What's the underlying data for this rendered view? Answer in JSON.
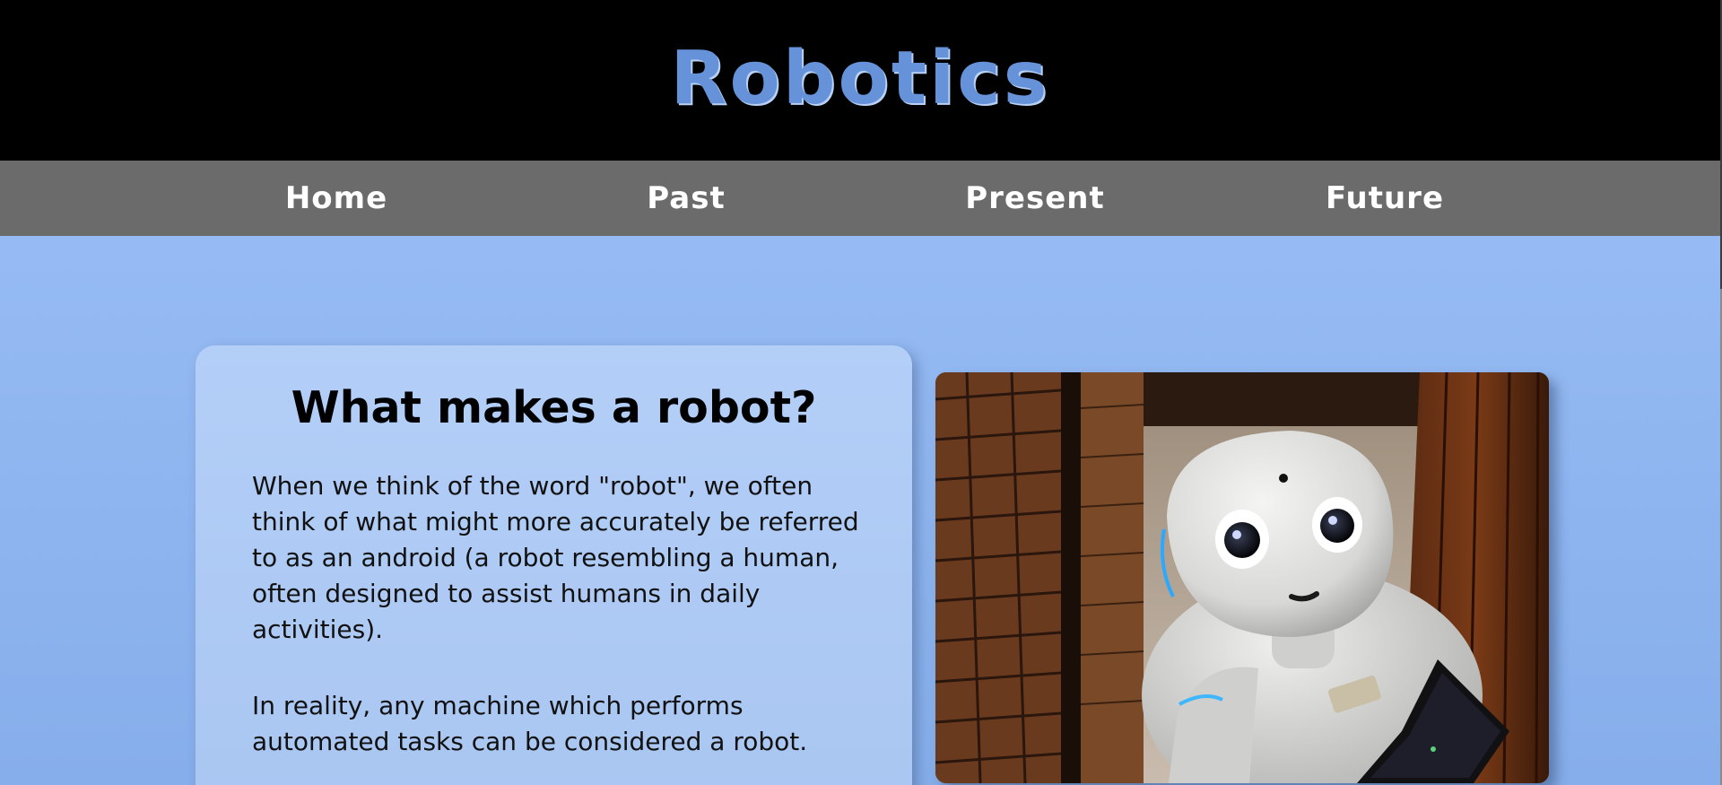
{
  "header": {
    "title": "Robotics"
  },
  "nav": {
    "items": [
      {
        "label": "Home"
      },
      {
        "label": "Past"
      },
      {
        "label": "Present"
      },
      {
        "label": "Future"
      }
    ]
  },
  "main": {
    "card": {
      "heading": "What makes a robot?",
      "paragraphs": [
        "When we think of the word \"robot\", we often think of what might more accurately be referred to as an android (a robot resembling a human, often designed to assist humans in daily activities).",
        "In reality, any machine which performs automated tasks can be considered a robot."
      ]
    },
    "image": {
      "subject": "robot-photo"
    }
  },
  "colors": {
    "header_bg": "#000000",
    "title": "#6592d8",
    "nav_bg": "#6b6b6b",
    "nav_text": "#ffffff",
    "page_bg": "#96bbf4",
    "card_bg": "#b3cff8"
  }
}
